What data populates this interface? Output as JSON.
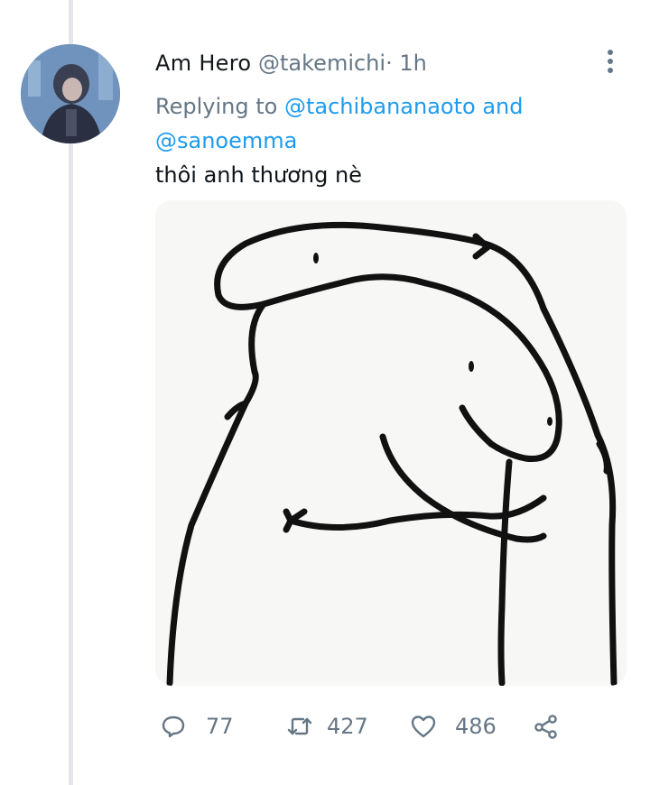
{
  "tweet": {
    "author_name": "Am Hero",
    "handle": "@takemichi",
    "separator": "·",
    "time": "1h",
    "replying_prefix": "Replying to",
    "reply_to_1": "@tachibananaoto",
    "reply_joiner": "and",
    "reply_to_2": "@sanoemma",
    "text": "thôi anh thương nè"
  },
  "actions": {
    "reply_icon": "reply-icon",
    "reply_count": "77",
    "retweet_icon": "retweet-icon",
    "retweet_count": "427",
    "like_icon": "heart-icon",
    "like_count": "486",
    "share_icon": "share-icon"
  },
  "menu": {
    "more_icon": "more-vertical-icon"
  },
  "colors": {
    "text": "#0f1419",
    "muted": "#657786",
    "link": "#1d9bf0",
    "thread_line": "#e3e6ea"
  }
}
